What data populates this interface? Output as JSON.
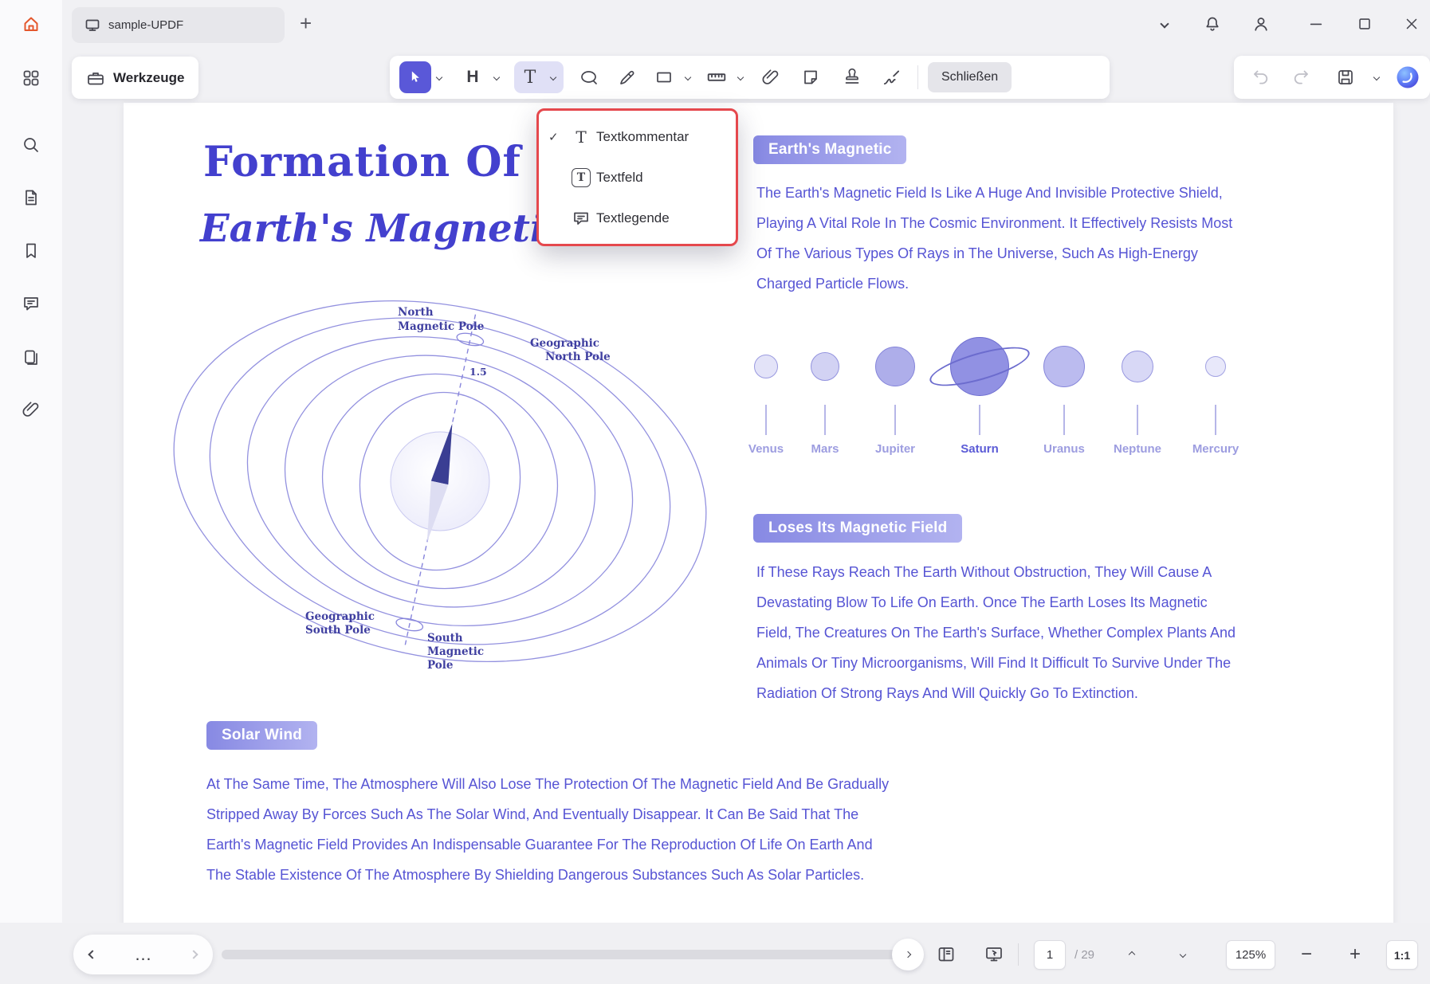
{
  "app": {
    "tab_title": "sample-UPDF",
    "toolbar": {
      "tools_button": "Werkzeuge",
      "close_button": "Schließen"
    },
    "text_menu": {
      "items": [
        {
          "label": "Textkommentar",
          "checked": "✓"
        },
        {
          "label": "Textfeld",
          "checked": ""
        },
        {
          "label": "Textlegende",
          "checked": ""
        }
      ]
    },
    "statusbar": {
      "more": "…",
      "page_current": "1",
      "page_total": "/ 29",
      "zoom_level": "125%",
      "actual_size": "1:1"
    }
  },
  "document": {
    "title": "Formation Of Th",
    "subtitle": "Earth's Magnetic F",
    "diagram": {
      "north_mag_1": "North",
      "north_mag_2": "Magnetic Pole",
      "geo_north_1": "Geographic",
      "geo_north_2": "North Pole",
      "tilt": "1.5",
      "geo_south_1": "Geographic",
      "geo_south_2": "South Pole",
      "south_mag_1": "South",
      "south_mag_2": "Magnetic",
      "south_mag_3": "Pole"
    },
    "sections": [
      {
        "heading": "Earth's Magnetic",
        "lines": [
          "The Earth's Magnetic Field Is Like A Huge And Invisible Protective Shield,",
          "Playing A Vital Role In The Cosmic Environment. It Effectively Resists Most",
          "Of The Various Types Of Rays in The Universe, Such As High-Energy",
          "Charged Particle Flows."
        ]
      },
      {
        "heading": "Loses Its Magnetic Field",
        "lines": [
          "If These Rays Reach The Earth Without Obstruction, They Will Cause A",
          "Devastating Blow To Life On Earth. Once The Earth Loses Its Magnetic",
          "Field, The Creatures On The Earth's Surface, Whether Complex Plants And",
          "Animals Or Tiny Microorganisms, Will Find It Difficult To Survive Under The",
          "Radiation Of Strong Rays And Will Quickly Go To Extinction."
        ]
      },
      {
        "heading": "Solar Wind",
        "lines": [
          "At The Same Time, The Atmosphere Will Also Lose The Protection Of The Magnetic Field And Be Gradually",
          "Stripped Away By Forces Such As The Solar Wind, And Eventually Disappear. It Can Be Said That The",
          "Earth's Magnetic Field Provides An Indispensable Guarantee For The Reproduction Of Life On Earth And",
          "The Stable Existence Of The Atmosphere By Shielding Dangerous Substances Such As Solar Particles."
        ]
      }
    ],
    "planets": [
      {
        "name": "Venus"
      },
      {
        "name": "Mars"
      },
      {
        "name": "Jupiter"
      },
      {
        "name": "Saturn"
      },
      {
        "name": "Uranus"
      },
      {
        "name": "Neptune"
      },
      {
        "name": "Mercury"
      }
    ]
  },
  "colors": {
    "accent": "#5B5BD6",
    "doc_title": "#4340CE",
    "menu_highlight_border": "#E5484D",
    "selected_tool_bg": "#5A58D8",
    "badge_gradient_start": "#8789E3",
    "badge_gradient_end": "#B2B3F0"
  }
}
